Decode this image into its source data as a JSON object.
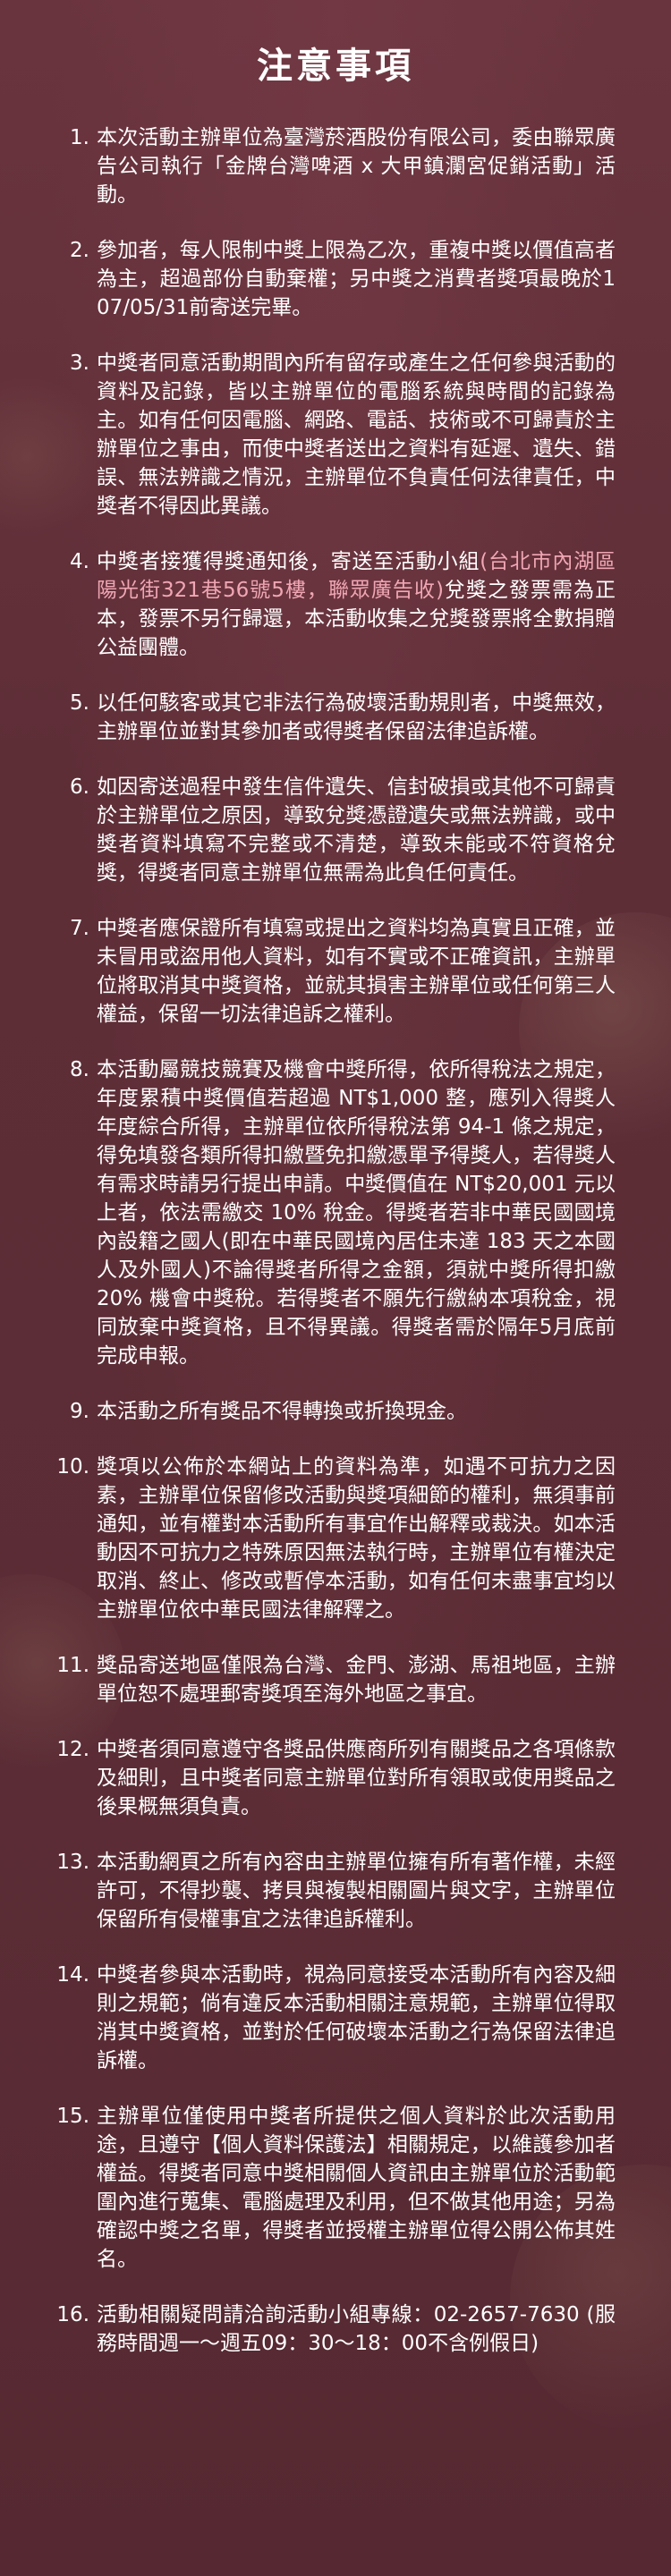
{
  "title": "注意事項",
  "colors": {
    "background": "#5e2e37",
    "text": "#ffffff",
    "highlight": "#f0a6b4"
  },
  "items": [
    {
      "num": "1.",
      "text": "本次活動主辦單位為臺灣菸酒股份有限公司，委由聯眾廣告公司執行「金牌台灣啤酒 x 大甲鎮瀾宮促銷活動」活動。"
    },
    {
      "num": "2.",
      "text": "參加者，每人限制中獎上限為乙次，重複中獎以價值高者為主，超過部份自動棄權；另中獎之消費者獎項最晚於107/05/31前寄送完畢。"
    },
    {
      "num": "3.",
      "text": "中獎者同意活動期間內所有留存或產生之任何參與活動的資料及記錄，皆以主辦單位的電腦系統與時間的記錄為主。如有任何因電腦、網路、電話、技術或不可歸責於主辦單位之事由，而使中獎者送出之資料有延遲、遺失、錯誤、無法辨識之情況，主辦單位不負責任何法律責任，中獎者不得因此異議。"
    },
    {
      "num": "4.",
      "text_before": "中獎者接獲得獎通知後，寄送至活動小組",
      "text_highlight": "(台北市內湖區陽光街321巷56號5樓，聯眾廣告收)",
      "text_after": "兌獎之發票需為正本，發票不另行歸還，本活動收集之兌獎發票將全數捐贈公益團體。"
    },
    {
      "num": "5.",
      "text": "以任何駭客或其它非法行為破壞活動規則者，中獎無效，主辦單位並對其參加者或得獎者保留法律追訴權。"
    },
    {
      "num": "6.",
      "text": "如因寄送過程中發生信件遺失、信封破損或其他不可歸責於主辦單位之原因，導致兌獎憑證遺失或無法辨識，或中獎者資料填寫不完整或不清楚，導致未能或不符資格兌獎，得獎者同意主辦單位無需為此負任何責任。"
    },
    {
      "num": "7.",
      "text": "中獎者應保證所有填寫或提出之資料均為真實且正確，並未冒用或盜用他人資料，如有不實或不正確資訊，主辦單位將取消其中獎資格，並就其損害主辦單位或任何第三人權益，保留一切法律追訴之權利。"
    },
    {
      "num": "8.",
      "text": "本活動屬競技競賽及機會中獎所得，依所得稅法之規定，年度累積中獎價值若超過 NT$1,000 整，應列入得獎人年度綜合所得，主辦單位依所得稅法第 94-1 條之規定，得免填發各類所得扣繳暨免扣繳憑單予得獎人，若得獎人有需求時請另行提出申請。中獎價值在 NT$20,001 元以上者，依法需繳交 10% 稅金。得獎者若非中華民國國境內設籍之國人(即在中華民國境內居住未達 183 天之本國人及外國人)不論得獎者所得之金額，須就中獎所得扣繳 20% 機會中獎稅。若得獎者不願先行繳納本項稅金，視同放棄中獎資格，且不得異議。得獎者需於隔年5月底前完成申報。"
    },
    {
      "num": "9.",
      "text": "本活動之所有獎品不得轉換或折換現金。"
    },
    {
      "num": "10.",
      "text": "獎項以公佈於本網站上的資料為準，如遇不可抗力之因素，主辦單位保留修改活動與獎項細節的權利，無須事前通知，並有權對本活動所有事宜作出解釋或裁決。如本活動因不可抗力之特殊原因無法執行時，主辦單位有權決定取消、終止、修改或暫停本活動，如有任何未盡事宜均以主辦單位依中華民國法律解釋之。"
    },
    {
      "num": "11.",
      "text": "獎品寄送地區僅限為台灣、金門、澎湖、馬祖地區，主辦單位恕不處理郵寄獎項至海外地區之事宜。"
    },
    {
      "num": "12.",
      "text": "中獎者須同意遵守各獎品供應商所列有關獎品之各項條款及細則，且中獎者同意主辦單位對所有領取或使用獎品之後果概無須負責。"
    },
    {
      "num": "13.",
      "text": "本活動網頁之所有內容由主辦單位擁有所有著作權，未經許可，不得抄襲、拷貝與複製相關圖片與文字，主辦單位保留所有侵權事宜之法律追訴權利。"
    },
    {
      "num": "14.",
      "text": "中獎者參與本活動時，視為同意接受本活動所有內容及細則之規範；倘有違反本活動相關注意規範，主辦單位得取消其中獎資格，並對於任何破壞本活動之行為保留法律追訴權。"
    },
    {
      "num": "15.",
      "text": "主辦單位僅使用中獎者所提供之個人資料於此次活動用途，且遵守【個人資料保護法】相關規定，以維護參加者權益。得獎者同意中獎相關個人資訊由主辦單位於活動範圍內進行蒐集、電腦處理及利用，但不做其他用途；另為確認中獎之名單，得獎者並授權主辦單位得公開公佈其姓名。"
    },
    {
      "num": "16.",
      "text": "活動相關疑問請洽詢活動小組專線：02-2657-7630 (服務時間週一～週五09：30～18：00不含例假日)"
    }
  ]
}
